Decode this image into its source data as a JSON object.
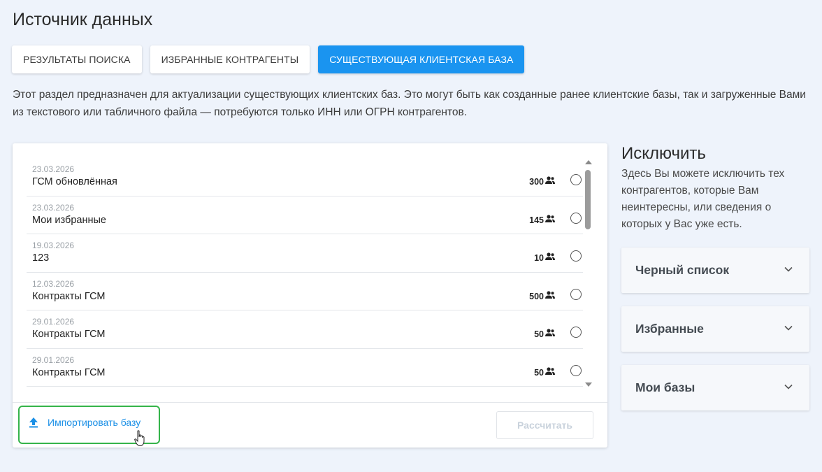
{
  "page": {
    "title": "Источник данных",
    "description": "Этот раздел предназначен для актуализации существующих клиентских баз. Это могут быть как созданные ранее клиентские базы, так и загруженные Вами из текстового или табличного файла — потребуются только ИНН или ОГРН контрагентов."
  },
  "tabs": [
    {
      "label": "Результаты поиска",
      "active": false
    },
    {
      "label": "Избранные контрагенты",
      "active": false
    },
    {
      "label": "Существующая клиентская база",
      "active": true
    }
  ],
  "bases": [
    {
      "date": "23.03.2026",
      "name": "ГСМ обновлённая",
      "count": "300"
    },
    {
      "date": "23.03.2026",
      "name": "Мои избранные",
      "count": "145"
    },
    {
      "date": "19.03.2026",
      "name": "123",
      "count": "10"
    },
    {
      "date": "12.03.2026",
      "name": "Контракты ГСМ",
      "count": "500"
    },
    {
      "date": "29.01.2026",
      "name": "Контракты ГСМ",
      "count": "50"
    },
    {
      "date": "29.01.2026",
      "name": "Контракты ГСМ",
      "count": "50"
    }
  ],
  "actions": {
    "import_label": "Импортировать базу",
    "calculate_label": "Рассчитать"
  },
  "exclude": {
    "title": "Исключить",
    "description": "Здесь Вы можете исключить тех контрагентов, которые Вам неинтересны, или сведения о которых у Вас уже есть.",
    "sections": [
      {
        "label": "Черный список"
      },
      {
        "label": "Избранные"
      },
      {
        "label": "Мои базы"
      }
    ]
  },
  "colors": {
    "accent": "#1a94f0",
    "highlight": "#35b44a",
    "background": "#eef3fb"
  },
  "icons": {
    "count": "people-icon",
    "import": "upload-icon",
    "accordion": "chevron-down-icon",
    "pointer": "hand-cursor-icon"
  }
}
